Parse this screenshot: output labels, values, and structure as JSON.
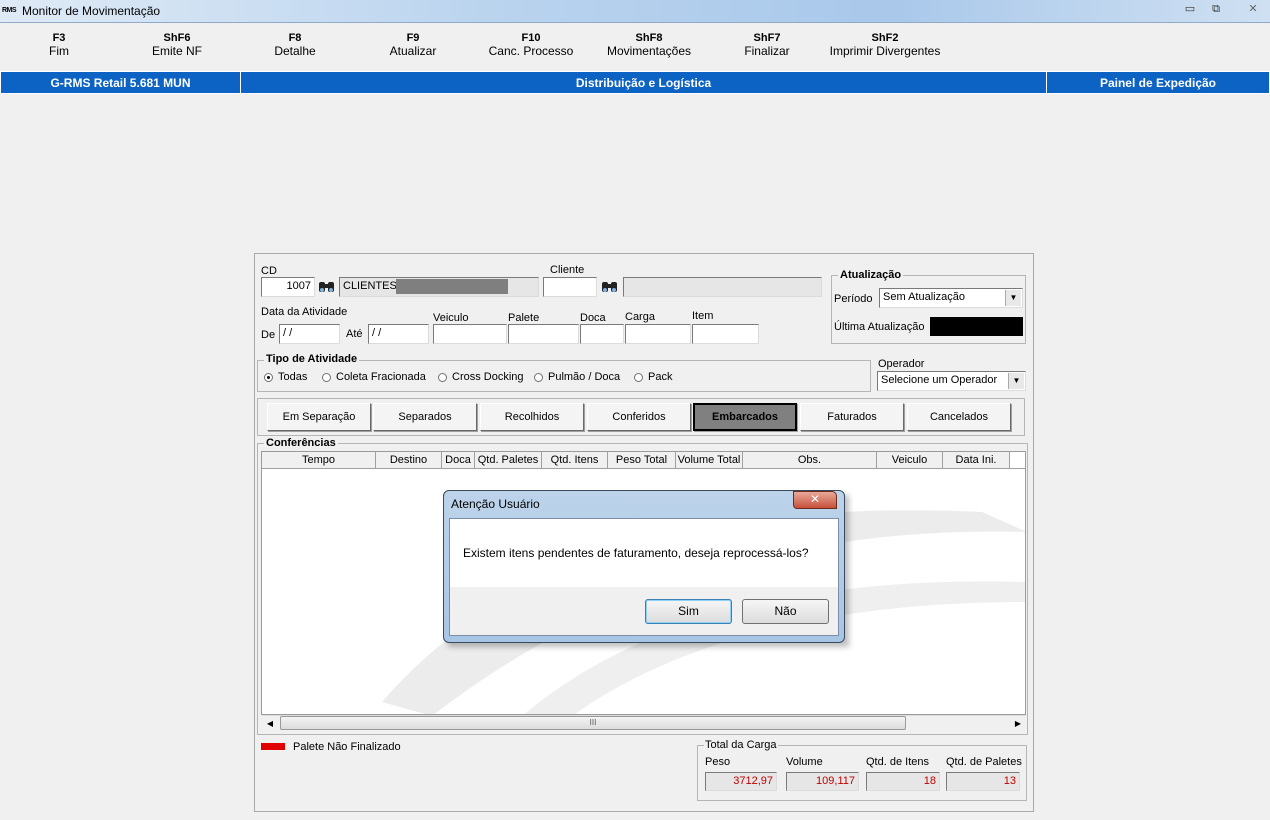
{
  "window": {
    "icon_text": "RMS",
    "title": "Monitor de Movimentação",
    "minimize_glyph": "▭",
    "restore_glyph": "⧉",
    "close_glyph": "✕"
  },
  "toolbar": [
    {
      "key": "F3",
      "label": "Fim"
    },
    {
      "key": "ShF6",
      "label": "Emite NF"
    },
    {
      "key": "F8",
      "label": "Detalhe"
    },
    {
      "key": "F9",
      "label": "Atualizar"
    },
    {
      "key": "F10",
      "label": "Canc. Processo"
    },
    {
      "key": "ShF8",
      "label": "Movimentações"
    },
    {
      "key": "ShF7",
      "label": "Finalizar"
    },
    {
      "key": "ShF2",
      "label": "Imprimir Divergentes"
    }
  ],
  "header": {
    "left": "G-RMS Retail 5.681 MUN",
    "center": "Distribuição e Logística",
    "right": "Painel de Expedição"
  },
  "filters": {
    "cd_label": "CD",
    "cd_value": "1007",
    "cd_name": "CLIENTES_",
    "cliente_label": "Cliente",
    "cliente_value": "",
    "data_atividade_label": "Data da Atividade",
    "de_label": "De",
    "de_value": " / /",
    "ate_label": "Até",
    "ate_value": " / /",
    "veiculo_label": "Veiculo",
    "palete_label": "Palete",
    "doca_label": "Doca",
    "carga_label": "Carga",
    "item_label": "Item"
  },
  "atualizacao": {
    "title": "Atualização",
    "periodo_label": "Período",
    "periodo_value": "Sem Atualização",
    "ultima_label": "Última Atualização"
  },
  "tipo_atividade": {
    "title": "Tipo de Atividade",
    "options": [
      "Todas",
      "Coleta Fracionada",
      "Cross Docking",
      "Pulmão / Doca",
      "Pack"
    ],
    "selected": "Todas"
  },
  "operador": {
    "label": "Operador",
    "value": "Selecione um Operador"
  },
  "tabs": [
    "Em Separação",
    "Separados",
    "Recolhidos",
    "Conferidos",
    "Embarcados",
    "Faturados",
    "Cancelados"
  ],
  "active_tab": "Embarcados",
  "conferencias": {
    "title": "Conferências",
    "columns": [
      "Tempo",
      "Destino",
      "Doca",
      "Qtd. Paletes",
      "Qtd. Itens",
      "Peso Total",
      "Volume Total",
      "Obs.",
      "Veiculo",
      "Data Ini."
    ],
    "scroll_thumb_glyph": "III"
  },
  "legend": {
    "label": "Palete Não Finalizado",
    "color": "#e00000"
  },
  "total_carga": {
    "title": "Total da Carga",
    "peso_label": "Peso",
    "peso_value": "3712,97",
    "volume_label": "Volume",
    "volume_value": "109,117",
    "itens_label": "Qtd. de Itens",
    "itens_value": "18",
    "paletes_label": "Qtd. de Paletes",
    "paletes_value": "13",
    "value_color": "#c00000"
  },
  "dialog": {
    "title": "Atenção Usuário",
    "message": "Existem itens pendentes de faturamento, deseja reprocessá-los?",
    "yes_label": "Sim",
    "no_label": "Não",
    "close_glyph": "✕"
  },
  "colors": {
    "header_blue": "#0c63c4",
    "active_tab_bg": "#808080"
  }
}
